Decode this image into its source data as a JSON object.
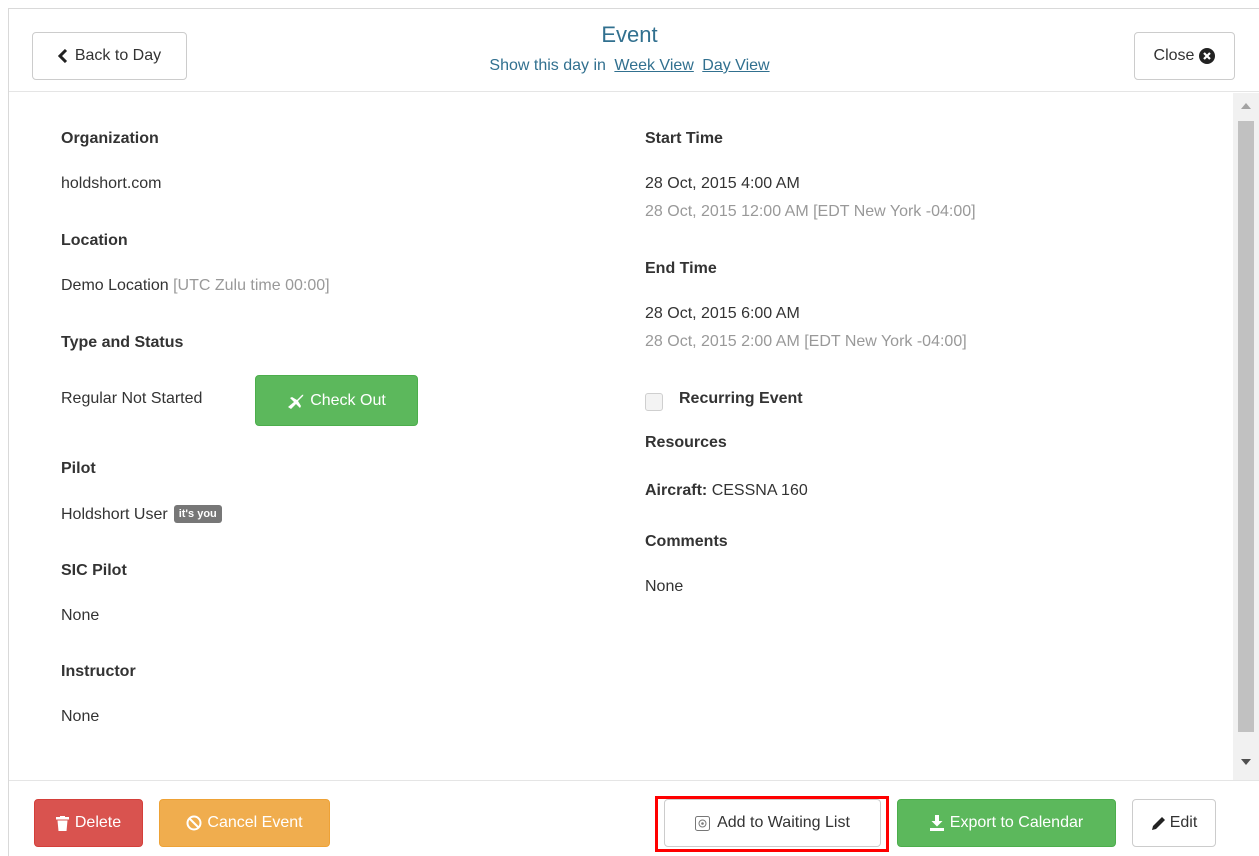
{
  "header": {
    "back_label": "Back to Day",
    "title": "Event",
    "subtitle_prefix": "Show this day in",
    "week_view_link": "Week View",
    "day_view_link": "Day View",
    "close_label": "Close"
  },
  "left": {
    "organization_label": "Organization",
    "organization_value": "holdshort.com",
    "location_label": "Location",
    "location_value": "Demo Location",
    "location_tz": "[UTC Zulu time 00:00]",
    "type_status_label": "Type and Status",
    "type_status_value": "Regular Not Started",
    "checkout_label": "Check Out",
    "pilot_label": "Pilot",
    "pilot_value": "Holdshort User",
    "pilot_badge": "it's you",
    "sic_label": "SIC Pilot",
    "sic_value": "None",
    "instructor_label": "Instructor",
    "instructor_value": "None"
  },
  "right": {
    "start_label": "Start Time",
    "start_value": "28 Oct, 2015 4:00 AM",
    "start_local": "28 Oct, 2015 12:00 AM [EDT New York -04:00]",
    "end_label": "End Time",
    "end_value": "28 Oct, 2015 6:00 AM",
    "end_local": "28 Oct, 2015 2:00 AM [EDT New York -04:00]",
    "recurring_label": "Recurring Event",
    "recurring_checked": false,
    "resources_label": "Resources",
    "aircraft_label": "Aircraft:",
    "aircraft_value": "CESSNA 160",
    "comments_label": "Comments",
    "comments_value": "None"
  },
  "footer": {
    "delete_label": "Delete",
    "cancel_label": "Cancel Event",
    "waiting_list_label": "Add to Waiting List",
    "export_label": "Export to Calendar",
    "edit_label": "Edit"
  },
  "colors": {
    "success": "#5cb85c",
    "danger": "#d9534f",
    "warning": "#f0ad4e",
    "info_text": "#31708f",
    "highlight": "#ff0000"
  },
  "icons": {
    "back": "chevron-left-icon",
    "close": "times-circle-icon",
    "checkout": "plane-icon",
    "delete": "trash-icon",
    "cancel": "ban-icon",
    "waiting_list": "waiting-list-icon",
    "export": "download-icon",
    "edit": "pencil-icon"
  }
}
